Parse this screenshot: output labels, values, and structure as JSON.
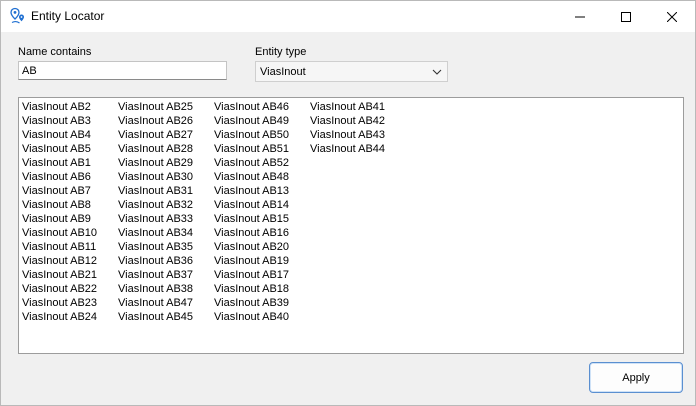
{
  "window": {
    "title": "Entity Locator"
  },
  "form": {
    "name_label": "Name contains",
    "name_value": "AB",
    "type_label": "Entity type",
    "type_value": "ViasInout"
  },
  "results": {
    "columns": [
      [
        "ViasInout AB2",
        "ViasInout AB3",
        "ViasInout AB4",
        "ViasInout AB5",
        "ViasInout AB1",
        "ViasInout AB6",
        "ViasInout AB7",
        "ViasInout AB8",
        "ViasInout AB9",
        "ViasInout AB10",
        "ViasInout AB11",
        "ViasInout AB12",
        "ViasInout AB21",
        "ViasInout AB22",
        "ViasInout AB23",
        "ViasInout AB24"
      ],
      [
        "ViasInout AB25",
        "ViasInout AB26",
        "ViasInout AB27",
        "ViasInout AB28",
        "ViasInout AB29",
        "ViasInout AB30",
        "ViasInout AB31",
        "ViasInout AB32",
        "ViasInout AB33",
        "ViasInout AB34",
        "ViasInout AB35",
        "ViasInout AB36",
        "ViasInout AB37",
        "ViasInout AB38",
        "ViasInout AB47",
        "ViasInout AB45"
      ],
      [
        "ViasInout AB46",
        "ViasInout AB49",
        "ViasInout AB50",
        "ViasInout AB51",
        "ViasInout AB52",
        "ViasInout AB48",
        "ViasInout AB13",
        "ViasInout AB14",
        "ViasInout AB15",
        "ViasInout AB16",
        "ViasInout AB20",
        "ViasInout AB19",
        "ViasInout AB17",
        "ViasInout AB18",
        "ViasInout AB39",
        "ViasInout AB40"
      ],
      [
        "ViasInout AB41",
        "ViasInout AB42",
        "ViasInout AB43",
        "ViasInout AB44"
      ]
    ]
  },
  "footer": {
    "apply_label": "Apply"
  },
  "icons": {
    "app": "map-pin-icon",
    "minimize": "minimize-icon",
    "maximize": "maximize-icon",
    "close": "close-icon",
    "dropdown": "chevron-down-icon"
  },
  "colors": {
    "accent": "#5a8fd0",
    "pin_blue": "#1f6fd1"
  }
}
